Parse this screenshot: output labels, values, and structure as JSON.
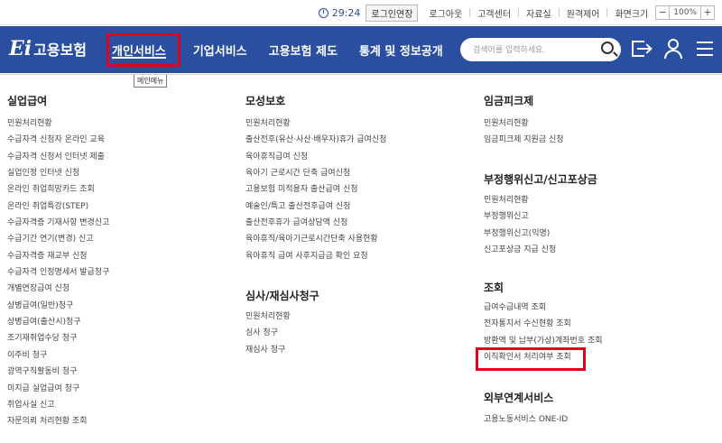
{
  "topbar": {
    "timer": "29:24",
    "extend_login": "로그인연장",
    "links": [
      "로그아웃",
      "고객센터",
      "자료실",
      "원격제어",
      "화면크기"
    ],
    "zoom_minus": "−",
    "zoom_value": "100%",
    "zoom_plus": "+"
  },
  "header": {
    "logo_mark": "Ei",
    "logo_name": "고용보험",
    "gnb": [
      "개인서비스",
      "기업서비스",
      "고용보험 제도",
      "통계 및 정보공개"
    ],
    "search_placeholder": "검색어를 입력하세요.",
    "tooltip": "메인메뉴",
    "colors": {
      "header_bg": "#2a4ea0",
      "highlight": "#e3001b"
    }
  },
  "menu": {
    "col1": [
      {
        "title": "실업급여",
        "items": [
          "민원처리현황",
          "수급자격 신청자 온라인 교육",
          "수급자격 신청서 인터넷 제출",
          "실업인정 인터넷 신청",
          "온라인 취업희망카드 조회",
          "온라인 취업특강(STEP)",
          "수급자격증 기재사항 변경신고",
          "수급기간 연기(변경) 신고",
          "수급자격증 재교부 신청",
          "수급자격 인정명세서 발급청구",
          "개별연장급여 신청",
          "상병급여(일반)청구",
          "상병급여(출산시)청구",
          "조기재취업수당 청구",
          "이주비 청구",
          "광역구직활동비 청구",
          "미지급 실업급여 청구",
          "취업사실 신고",
          "자문의뢰 처리현황 조회"
        ]
      }
    ],
    "col2": [
      {
        "title": "모성보호",
        "items": [
          "민원처리현황",
          "출산전후(유산·사산·배우자)휴가 급여신청",
          "육아휴직급여 신청",
          "육아기 근로시간 단축 급여신청",
          "고용보험 미적용자 출산급여 신청",
          "예술인/특고 출산전후급여 신청",
          "출산전후휴가 급여상담액 신청",
          "육아휴직/육아기근로시간단축 사용현황",
          "육아휴직 급여 사후지급금 확인 요청"
        ]
      },
      {
        "title": "심사/재심사청구",
        "items": [
          "민원처리현황",
          "심사 청구",
          "재심사 청구"
        ]
      }
    ],
    "col3": [
      {
        "title": "임금피크제",
        "items": [
          "민원처리현황",
          "임금피크제 지원금 신청"
        ]
      },
      {
        "title": "부정행위신고/신고포상금",
        "items": [
          "민원처리현황",
          "부정행위신고",
          "부정행위신고(익명)",
          "신고포상금 지급 신청"
        ]
      },
      {
        "title": "조회",
        "items": [
          "급여수급내역 조회",
          "전자통지서 수신현황 조회",
          "방환액 및 납부(가상)계좌번호 조회",
          "이직확인서 처리여부 조회"
        ]
      },
      {
        "title": "외부연계서비스",
        "items": [
          "고용노동서비스 ONE-ID"
        ]
      }
    ]
  }
}
